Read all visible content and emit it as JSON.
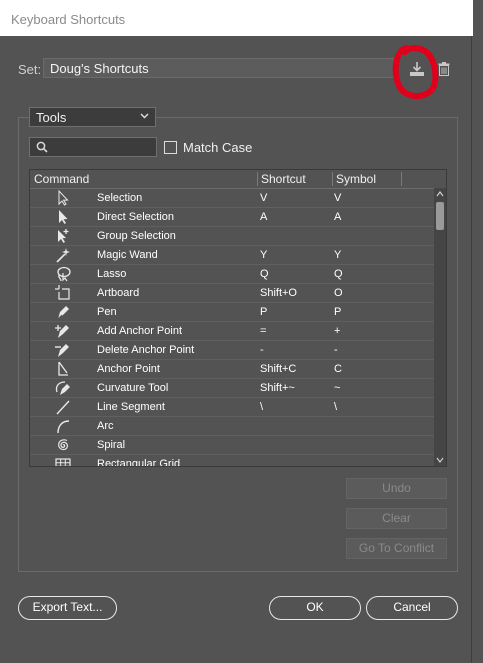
{
  "window": {
    "title": "Keyboard Shortcuts"
  },
  "set": {
    "label": "Set:",
    "value": "Doug's Shortcuts"
  },
  "filter": {
    "category": "Tools",
    "search_placeholder": "",
    "match_case_label": "Match Case"
  },
  "table": {
    "columns": [
      "Command",
      "Shortcut",
      "Symbol"
    ],
    "rows": [
      {
        "icon": "selection-icon",
        "command": "Selection",
        "shortcut": "V",
        "symbol": "V"
      },
      {
        "icon": "direct-selection-icon",
        "command": "Direct Selection",
        "shortcut": "A",
        "symbol": "A"
      },
      {
        "icon": "group-selection-icon",
        "command": "Group Selection",
        "shortcut": "",
        "symbol": ""
      },
      {
        "icon": "magic-wand-icon",
        "command": "Magic Wand",
        "shortcut": "Y",
        "symbol": "Y"
      },
      {
        "icon": "lasso-icon",
        "command": "Lasso",
        "shortcut": "Q",
        "symbol": "Q"
      },
      {
        "icon": "artboard-icon",
        "command": "Artboard",
        "shortcut": "Shift+O",
        "symbol": "O"
      },
      {
        "icon": "pen-icon",
        "command": "Pen",
        "shortcut": "P",
        "symbol": "P"
      },
      {
        "icon": "add-anchor-point-icon",
        "command": "Add Anchor Point",
        "shortcut": "=",
        "symbol": "+"
      },
      {
        "icon": "delete-anchor-point-icon",
        "command": "Delete Anchor Point",
        "shortcut": "-",
        "symbol": "-"
      },
      {
        "icon": "anchor-point-icon",
        "command": "Anchor Point",
        "shortcut": "Shift+C",
        "symbol": "C"
      },
      {
        "icon": "curvature-tool-icon",
        "command": "Curvature Tool",
        "shortcut": "Shift+~",
        "symbol": "~"
      },
      {
        "icon": "line-segment-icon",
        "command": "Line Segment",
        "shortcut": "\\",
        "symbol": "\\"
      },
      {
        "icon": "arc-icon",
        "command": "Arc",
        "shortcut": "",
        "symbol": ""
      },
      {
        "icon": "spiral-icon",
        "command": "Spiral",
        "shortcut": "",
        "symbol": ""
      },
      {
        "icon": "rectangular-grid-icon",
        "command": "Rectangular Grid",
        "shortcut": "",
        "symbol": ""
      }
    ]
  },
  "buttons": {
    "undo": "Undo",
    "clear": "Clear",
    "go_to_conflict": "Go To Conflict",
    "export_text": "Export Text...",
    "ok": "OK",
    "cancel": "Cancel"
  },
  "colors": {
    "background": "#535353",
    "annotation": "#e0001b"
  }
}
